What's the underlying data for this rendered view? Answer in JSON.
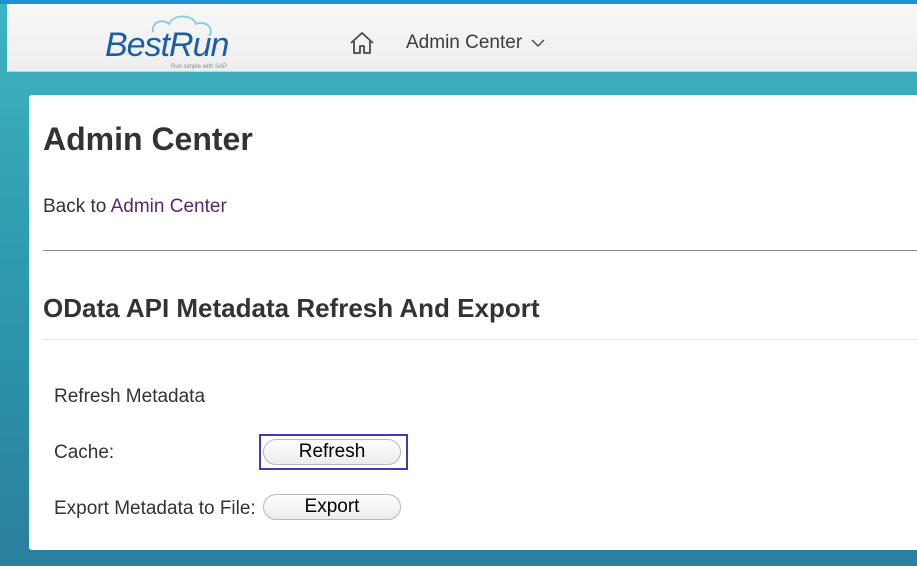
{
  "header": {
    "logo_text": "BestRun",
    "logo_tagline": "Run simple with SAP",
    "home_icon": "home-icon",
    "nav_menu_label": "Admin Center",
    "nav_menu_icon": "chevron-down-icon"
  },
  "page": {
    "title": "Admin Center",
    "back_prefix": "Back to",
    "back_link": "Admin Center",
    "section_title": "OData API Metadata Refresh And Export"
  },
  "form": {
    "group_label": "Refresh Metadata",
    "cache_label": "Cache:",
    "refresh_button": "Refresh",
    "export_label": "Export Metadata to File:",
    "export_button": "Export"
  },
  "colors": {
    "link": "#55286f",
    "brand_blue": "#1d8fd6",
    "focus_ring": "#3c3cb4"
  }
}
